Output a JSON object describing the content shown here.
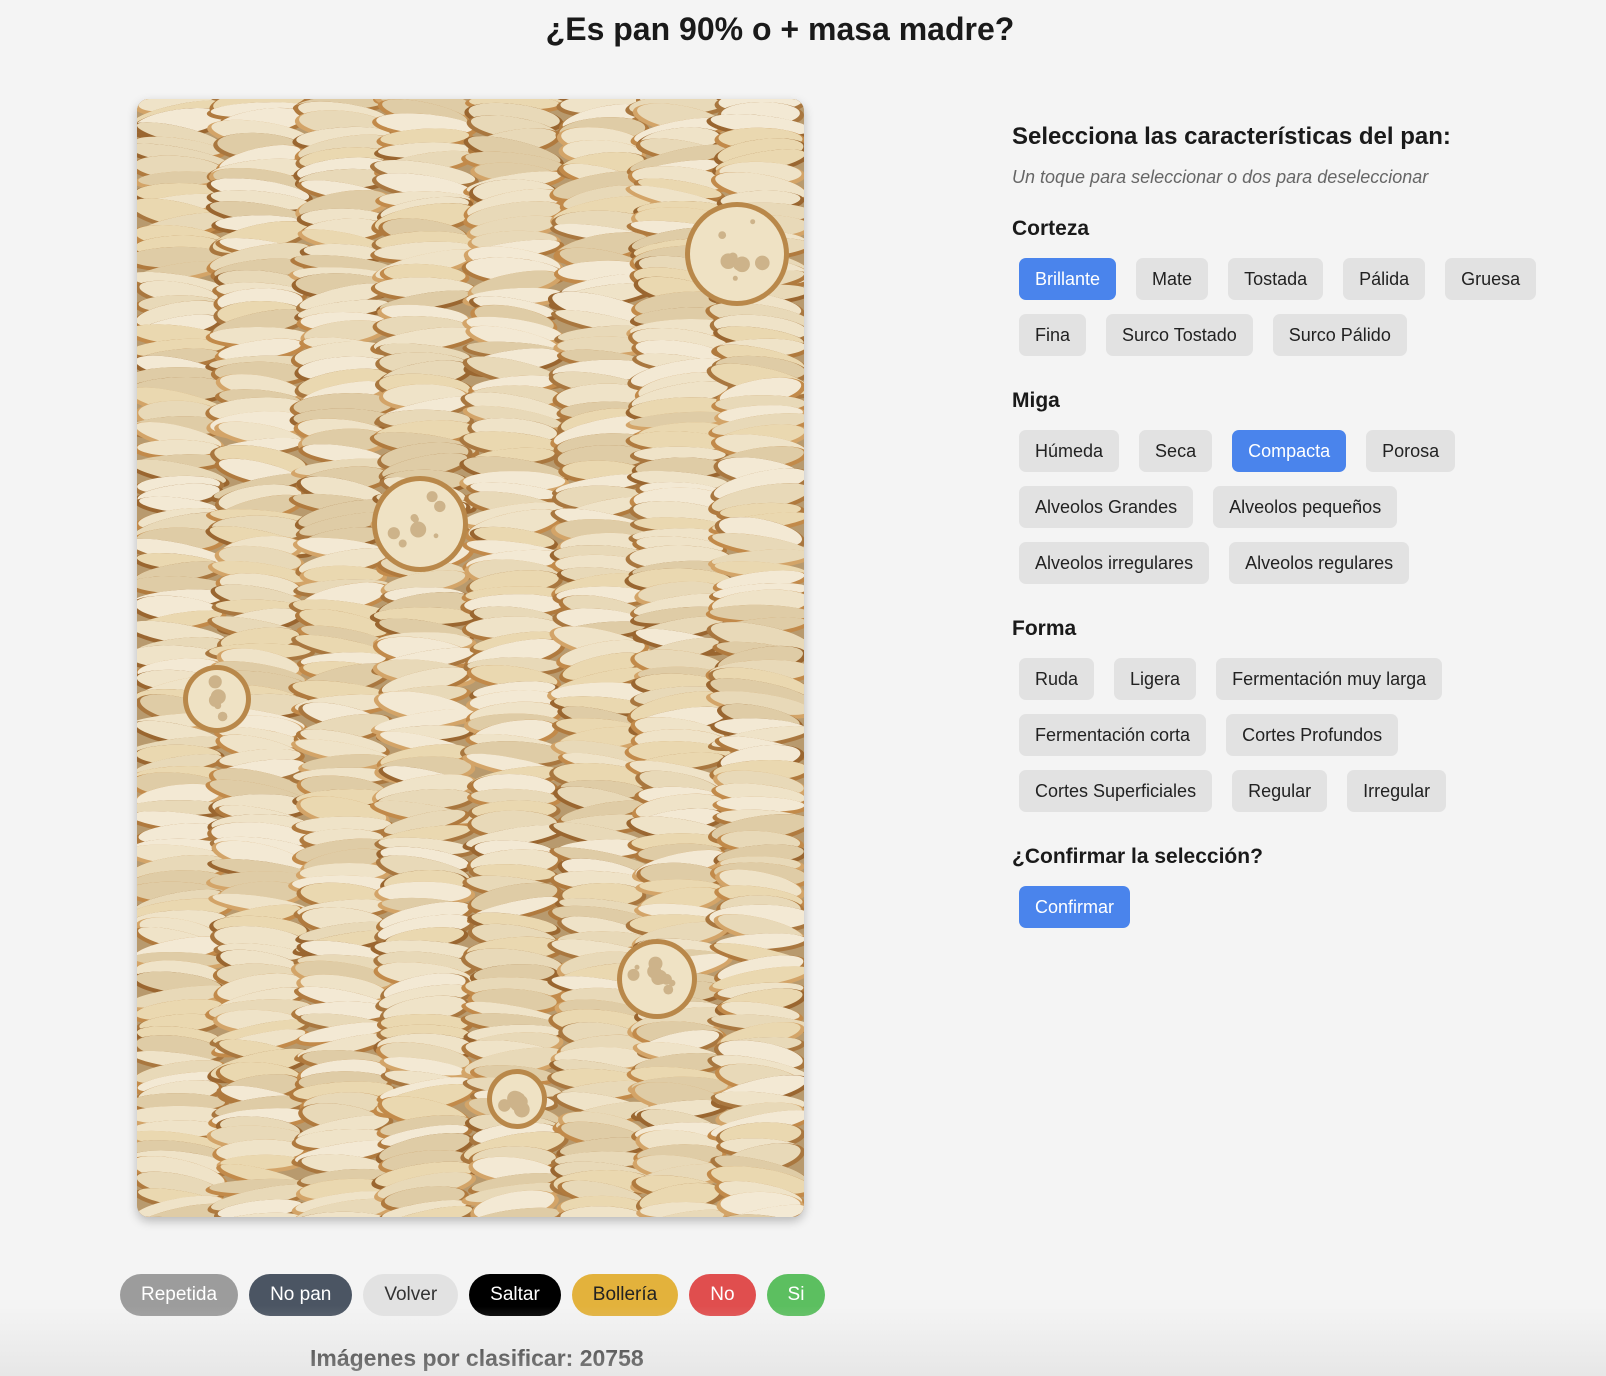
{
  "title": "¿Es pan 90% o + masa madre?",
  "image": {
    "subject": "bread-slices-photo"
  },
  "actions": [
    {
      "label": "Repetida",
      "name": "repetida-button",
      "bg": "#9c9c9c",
      "fg": "#ffffff"
    },
    {
      "label": "No pan",
      "name": "no-pan-button",
      "bg": "#4b5563",
      "fg": "#ffffff"
    },
    {
      "label": "Volver",
      "name": "volver-button",
      "bg": "#e2e2e2",
      "fg": "#333333"
    },
    {
      "label": "Saltar",
      "name": "saltar-button",
      "bg": "#000000",
      "fg": "#ffffff"
    },
    {
      "label": "Bollería",
      "name": "bolleria-button",
      "bg": "#e3b23c",
      "fg": "#222222"
    },
    {
      "label": "No",
      "name": "no-button",
      "bg": "#e04e4e",
      "fg": "#ffffff"
    },
    {
      "label": "Si",
      "name": "si-button",
      "bg": "#5cbf60",
      "fg": "#ffffff"
    }
  ],
  "counter": {
    "text": "Imágenes por clasificar: 20758"
  },
  "panel": {
    "heading": "Selecciona las características del pan:",
    "hint": "Un toque para seleccionar o dos para deseleccionar",
    "sections": [
      {
        "title": "Corteza",
        "options": [
          {
            "label": "Brillante",
            "selected": true
          },
          {
            "label": "Mate",
            "selected": false
          },
          {
            "label": "Tostada",
            "selected": false
          },
          {
            "label": "Pálida",
            "selected": false
          },
          {
            "label": "Gruesa",
            "selected": false
          },
          {
            "label": "Fina",
            "selected": false
          },
          {
            "label": "Surco Tostado",
            "selected": false
          },
          {
            "label": "Surco Pálido",
            "selected": false
          }
        ]
      },
      {
        "title": "Miga",
        "options": [
          {
            "label": "Húmeda",
            "selected": false
          },
          {
            "label": "Seca",
            "selected": false
          },
          {
            "label": "Compacta",
            "selected": true
          },
          {
            "label": "Porosa",
            "selected": false
          },
          {
            "label": "Alveolos Grandes",
            "selected": false
          },
          {
            "label": "Alveolos pequeños",
            "selected": false
          },
          {
            "label": "Alveolos irregulares",
            "selected": false
          },
          {
            "label": "Alveolos regulares",
            "selected": false
          }
        ]
      },
      {
        "title": "Forma",
        "options": [
          {
            "label": "Ruda",
            "selected": false
          },
          {
            "label": "Ligera",
            "selected": false
          },
          {
            "label": "Fermentación muy larga",
            "selected": false
          },
          {
            "label": "Fermentación corta",
            "selected": false
          },
          {
            "label": "Cortes Profundos",
            "selected": false
          },
          {
            "label": "Cortes Superficiales",
            "selected": false
          },
          {
            "label": "Regular",
            "selected": false
          },
          {
            "label": "Irregular",
            "selected": false
          }
        ]
      }
    ],
    "confirm_heading": "¿Confirmar la selección?",
    "confirm_label": "Confirmar"
  },
  "colors": {
    "accent": "#4a84ec",
    "chip_bg": "#e2e2e2",
    "page_bg": "#f4f4f4"
  }
}
